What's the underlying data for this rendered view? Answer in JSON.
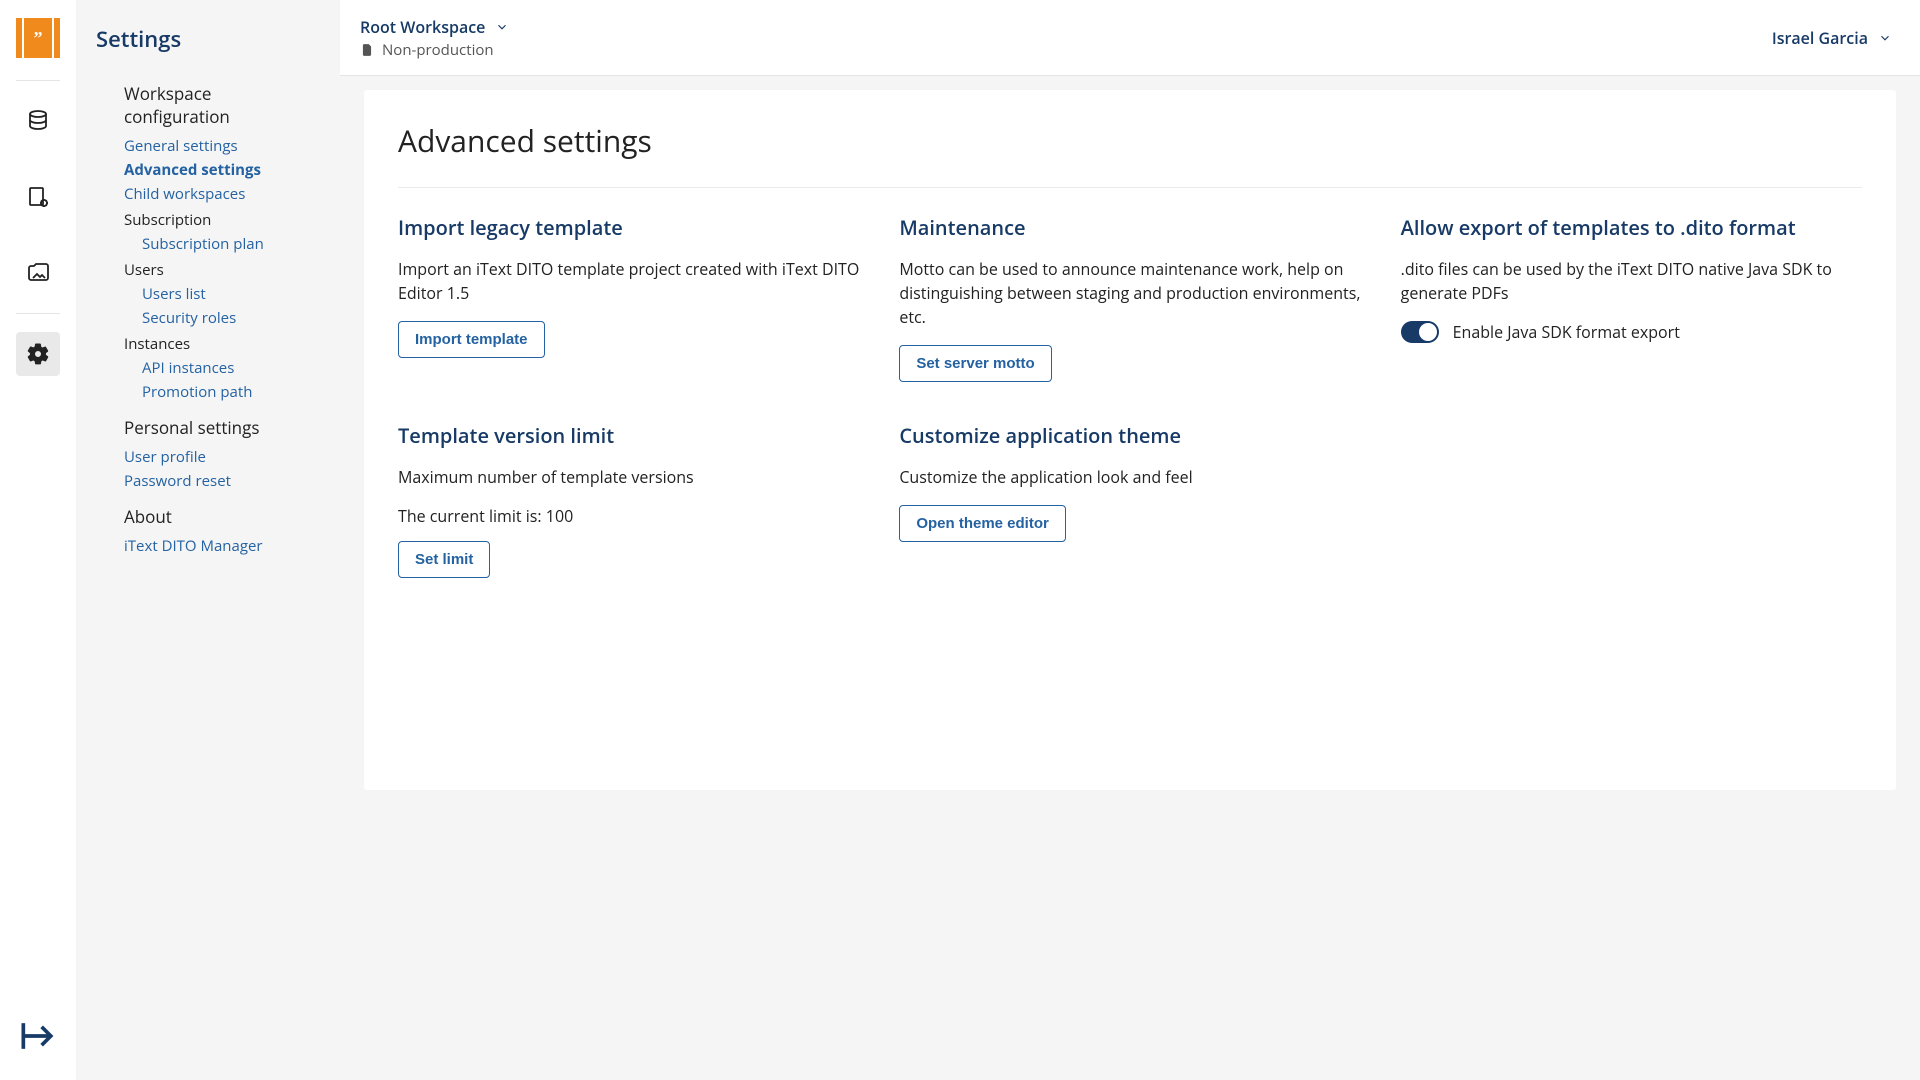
{
  "topbar": {
    "workspace": "Root Workspace",
    "environment": "Non-production",
    "user": "Israel Garcia"
  },
  "sidebar": {
    "title": "Settings",
    "sections": {
      "workspace_conf": "Workspace configuration",
      "general_settings": "General settings",
      "advanced_settings": "Advanced settings",
      "child_workspaces": "Child workspaces",
      "subscription": "Subscription",
      "subscription_plan": "Subscription plan",
      "users": "Users",
      "users_list": "Users list",
      "security_roles": "Security roles",
      "instances": "Instances",
      "api_instances": "API instances",
      "promotion_path": "Promotion path",
      "personal_settings": "Personal settings",
      "user_profile": "User profile",
      "password_reset": "Password reset",
      "about": "About",
      "about_item": "iText DITO Manager"
    }
  },
  "main": {
    "page_title": "Advanced settings",
    "cards": {
      "import_legacy": {
        "title": "Import legacy template",
        "desc": "Import an iText DITO template project created with iText DITO Editor 1.5",
        "button": "Import template"
      },
      "maintenance": {
        "title": "Maintenance",
        "desc": "Motto can be used to announce maintenance work, help on distinguishing between staging and production environments, etc.",
        "button": "Set server motto"
      },
      "allow_export": {
        "title": "Allow export of templates to .dito format",
        "desc": ".dito files can be used by the iText DITO native Java SDK to generate PDFs",
        "toggle_label": "Enable Java SDK format export"
      },
      "version_limit": {
        "title": "Template version limit",
        "desc": "Maximum number of template versions",
        "status": "The current limit is: 100",
        "button": "Set limit"
      },
      "theme": {
        "title": "Customize application theme",
        "desc": "Customize the application look and feel",
        "button": "Open theme editor"
      }
    }
  }
}
